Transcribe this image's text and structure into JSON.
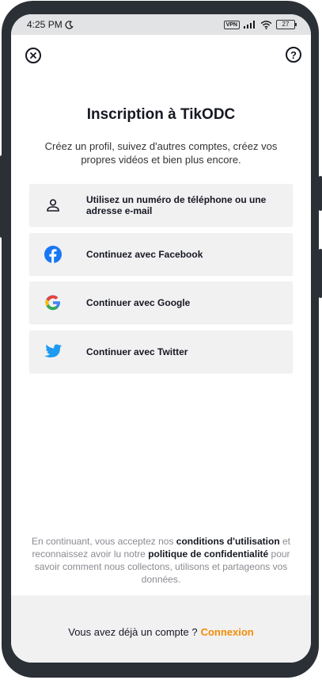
{
  "status_bar": {
    "time": "4:25 PM",
    "vpn": "VPN",
    "battery": "27"
  },
  "header": {
    "close_icon": "close-circle-icon",
    "help_icon": "help-circle-icon",
    "help_glyph": "?"
  },
  "main": {
    "title": "Inscription à TikODC",
    "subtitle": "Créez un profil, suivez d'autres comptes, créez vos propres vidéos et bien plus encore.",
    "options": [
      {
        "icon": "person-icon",
        "label": "Utilisez un numéro de téléphone ou une adresse e-mail"
      },
      {
        "icon": "facebook-icon",
        "label": "Continuez avec Facebook"
      },
      {
        "icon": "google-icon",
        "label": "Continuer avec Google"
      },
      {
        "icon": "twitter-icon",
        "label": "Continuer avec Twitter"
      }
    ]
  },
  "legal": {
    "part1": "En continuant, vous acceptez nos ",
    "terms_link": "conditions d'utilisation",
    "part2": " et reconnaissez avoir lu notre ",
    "privacy_link": "politique de confidentialité",
    "part3": " pour savoir comment nous collectons, utilisons et partageons vos données."
  },
  "footer": {
    "prompt": "Vous avez déjà un compte ?",
    "login_link": "Connexion"
  },
  "colors": {
    "accent": "#f28c06",
    "facebook": "#1877f2",
    "twitter": "#1d9bf0",
    "text": "#161823",
    "muted": "#8a8b91"
  }
}
